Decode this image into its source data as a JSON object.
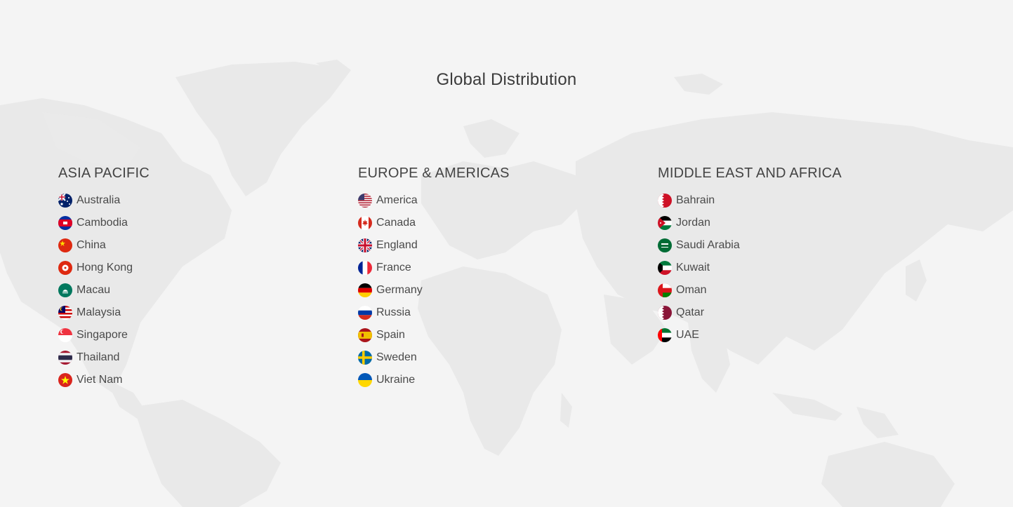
{
  "page": {
    "title": "Global Distribution"
  },
  "regions": [
    {
      "heading": "ASIA PACIFIC",
      "countries": [
        {
          "name": "Australia",
          "flag": "australia-flag-icon"
        },
        {
          "name": "Cambodia",
          "flag": "cambodia-flag-icon"
        },
        {
          "name": "China",
          "flag": "china-flag-icon"
        },
        {
          "name": "Hong Kong",
          "flag": "hong-kong-flag-icon"
        },
        {
          "name": "Macau",
          "flag": "macau-flag-icon"
        },
        {
          "name": "Malaysia",
          "flag": "malaysia-flag-icon"
        },
        {
          "name": "Singapore",
          "flag": "singapore-flag-icon"
        },
        {
          "name": "Thailand",
          "flag": "thailand-flag-icon"
        },
        {
          "name": "Viet Nam",
          "flag": "vietnam-flag-icon"
        }
      ]
    },
    {
      "heading": "EUROPE & AMERICAS",
      "countries": [
        {
          "name": "America",
          "flag": "usa-flag-icon"
        },
        {
          "name": "Canada",
          "flag": "canada-flag-icon"
        },
        {
          "name": "England",
          "flag": "uk-flag-icon"
        },
        {
          "name": "France",
          "flag": "france-flag-icon"
        },
        {
          "name": "Germany",
          "flag": "germany-flag-icon"
        },
        {
          "name": "Russia",
          "flag": "russia-flag-icon"
        },
        {
          "name": "Spain",
          "flag": "spain-flag-icon"
        },
        {
          "name": "Sweden",
          "flag": "sweden-flag-icon"
        },
        {
          "name": "Ukraine",
          "flag": "ukraine-flag-icon"
        }
      ]
    },
    {
      "heading": "MIDDLE EAST AND AFRICA",
      "countries": [
        {
          "name": "Bahrain",
          "flag": "bahrain-flag-icon"
        },
        {
          "name": "Jordan",
          "flag": "jordan-flag-icon"
        },
        {
          "name": "Saudi Arabia",
          "flag": "saudi-arabia-flag-icon"
        },
        {
          "name": "Kuwait",
          "flag": "kuwait-flag-icon"
        },
        {
          "name": "Oman",
          "flag": "oman-flag-icon"
        },
        {
          "name": "Qatar",
          "flag": "qatar-flag-icon"
        },
        {
          "name": "UAE",
          "flag": "uae-flag-icon"
        }
      ]
    }
  ],
  "colors": {
    "background": "#f4f4f4",
    "map_land": "#e9e9e9",
    "title_text": "#3b3b3b",
    "item_text": "#4a4a4a"
  }
}
